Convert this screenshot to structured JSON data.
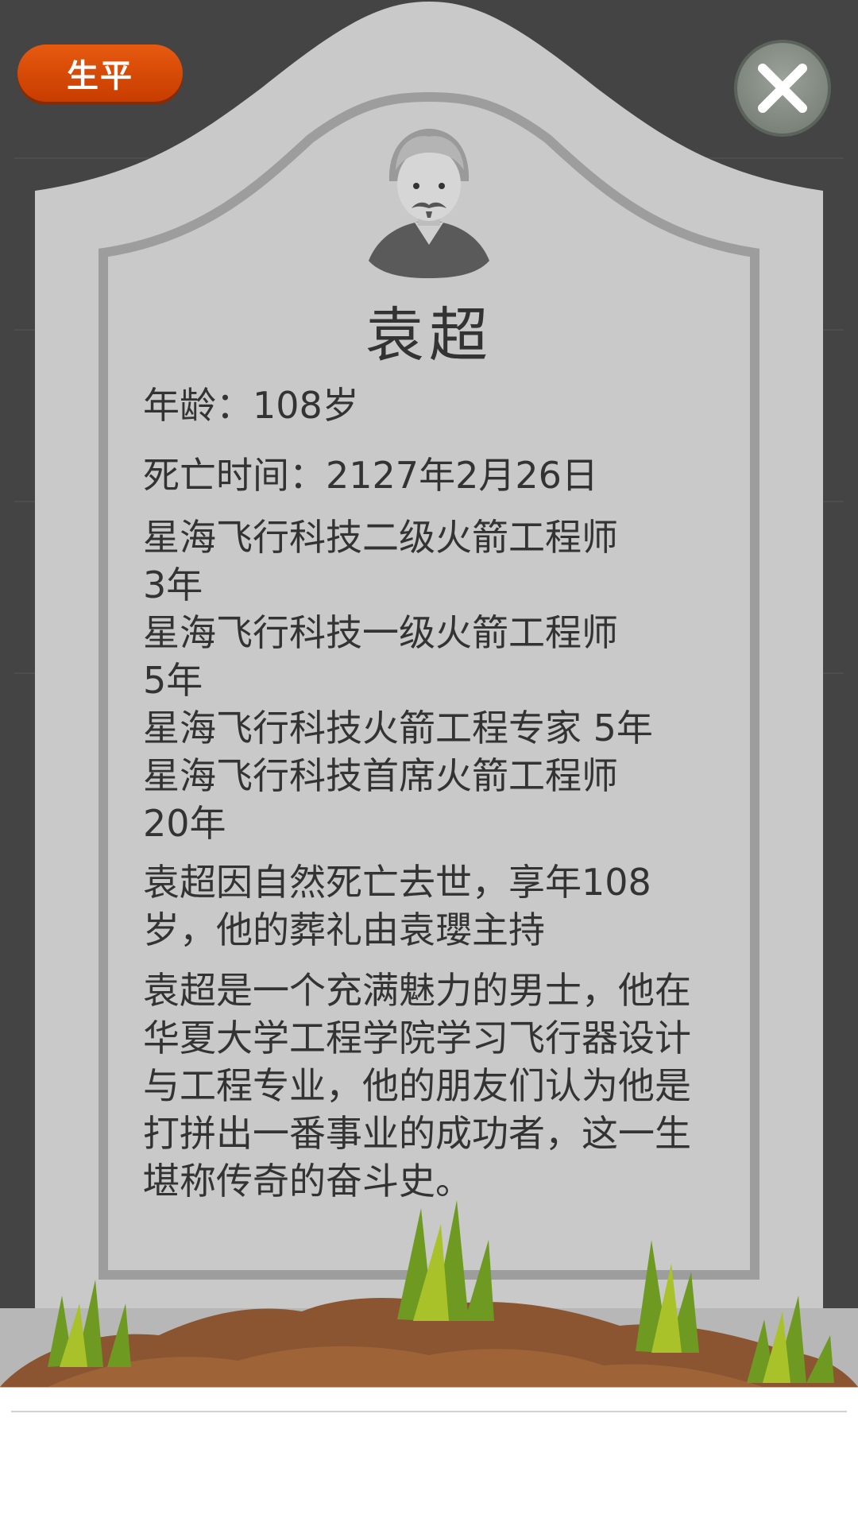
{
  "header": {
    "lifetime_label": "生平"
  },
  "close_icon": "close-icon",
  "profile": {
    "name": "袁超",
    "age_line": "年龄：108岁",
    "death_time_line": "死亡时间：2127年2月26日",
    "career": [
      "星海飞行科技二级火箭工程师",
      "3年",
      "星海飞行科技一级火箭工程师",
      "5年",
      "星海飞行科技火箭工程专家 5年",
      "星海飞行科技首席火箭工程师",
      "20年"
    ],
    "death_note": "袁超因自然死亡去世，享年108岁，他的葬礼由袁瓔主持",
    "biography": "袁超是一个充满魅力的男士，他在华夏大学工程学院学习飞行器设计与工程专业，他的朋友们认为他是打拼出一番事业的成功者，这一生堪称传奇的奋斗史。"
  },
  "colors": {
    "badge": "#d94a06",
    "tombstone": "#c9c9c9",
    "background": "#444444"
  }
}
